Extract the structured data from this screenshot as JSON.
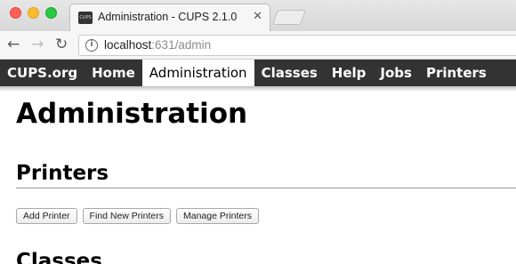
{
  "browser": {
    "tab_title": "Administration - CUPS 2.1.0",
    "favicon_label": "CUPS",
    "close_glyph": "✕",
    "url_host": "localhost",
    "url_rest": ":631/admin",
    "info_glyph": "i",
    "back_glyph": "←",
    "forward_glyph": "→",
    "reload_glyph": "↻"
  },
  "nav": {
    "items": [
      {
        "label": "CUPS.org",
        "active": false
      },
      {
        "label": "Home",
        "active": false
      },
      {
        "label": "Administration",
        "active": true
      },
      {
        "label": "Classes",
        "active": false
      },
      {
        "label": "Help",
        "active": false
      },
      {
        "label": "Jobs",
        "active": false
      },
      {
        "label": "Printers",
        "active": false
      }
    ]
  },
  "page": {
    "title": "Administration",
    "printers_heading": "Printers",
    "buttons": {
      "add_printer": "Add Printer",
      "find_new_printers": "Find New Printers",
      "manage_printers": "Manage Printers"
    },
    "next_heading": "Classes"
  },
  "colors": {
    "nav_bg": "#333333",
    "nav_active_bg": "#ffffff"
  }
}
